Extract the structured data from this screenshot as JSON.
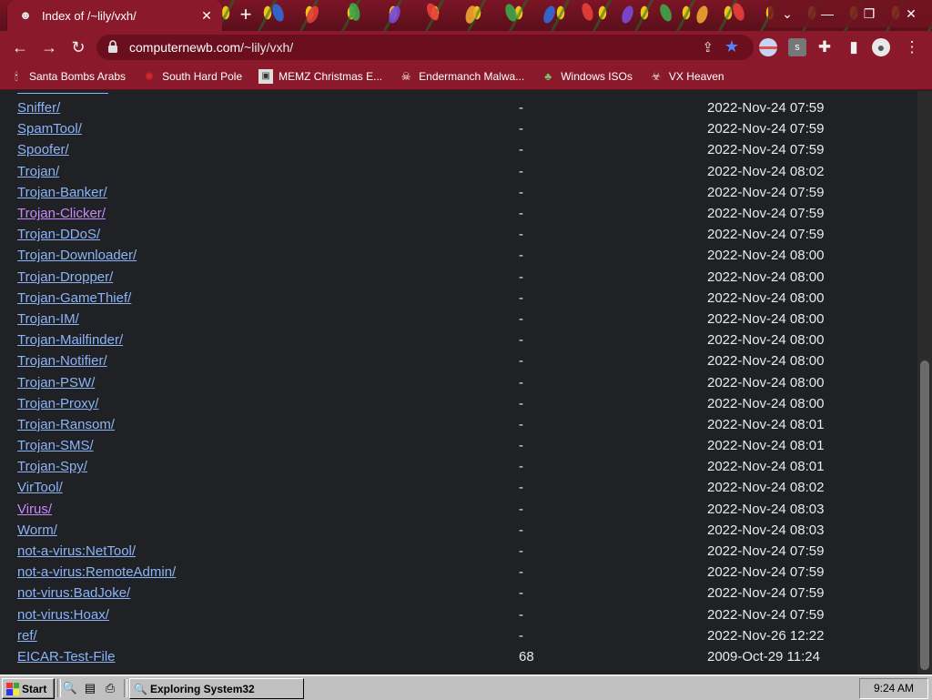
{
  "browser": {
    "tab_title": "Index of /~lily/vxh/",
    "url_host": "computernewb.com",
    "url_path": "/~lily/vxh/"
  },
  "bookmarks": [
    {
      "label": "Santa Bombs Arabs",
      "icon": "candle-icon"
    },
    {
      "label": "South Hard Pole",
      "icon": "asterisk-icon"
    },
    {
      "label": "MEMZ Christmas E...",
      "icon": "image-icon"
    },
    {
      "label": "Endermanch Malwa...",
      "icon": "skull-icon"
    },
    {
      "label": "Windows ISOs",
      "icon": "tree-icon"
    },
    {
      "label": "VX Heaven",
      "icon": "biohazard-icon"
    }
  ],
  "listing": [
    {
      "name": "Sniffer/",
      "size": "-",
      "date": "2022-Nov-24 07:59"
    },
    {
      "name": "SpamTool/",
      "size": "-",
      "date": "2022-Nov-24 07:59"
    },
    {
      "name": "Spoofer/",
      "size": "-",
      "date": "2022-Nov-24 07:59"
    },
    {
      "name": "Trojan/",
      "size": "-",
      "date": "2022-Nov-24 08:02"
    },
    {
      "name": "Trojan-Banker/",
      "size": "-",
      "date": "2022-Nov-24 07:59"
    },
    {
      "name": "Trojan-Clicker/",
      "size": "-",
      "date": "2022-Nov-24 07:59",
      "visited": true
    },
    {
      "name": "Trojan-DDoS/",
      "size": "-",
      "date": "2022-Nov-24 07:59"
    },
    {
      "name": "Trojan-Downloader/",
      "size": "-",
      "date": "2022-Nov-24 08:00"
    },
    {
      "name": "Trojan-Dropper/",
      "size": "-",
      "date": "2022-Nov-24 08:00"
    },
    {
      "name": "Trojan-GameThief/",
      "size": "-",
      "date": "2022-Nov-24 08:00"
    },
    {
      "name": "Trojan-IM/",
      "size": "-",
      "date": "2022-Nov-24 08:00"
    },
    {
      "name": "Trojan-Mailfinder/",
      "size": "-",
      "date": "2022-Nov-24 08:00"
    },
    {
      "name": "Trojan-Notifier/",
      "size": "-",
      "date": "2022-Nov-24 08:00"
    },
    {
      "name": "Trojan-PSW/",
      "size": "-",
      "date": "2022-Nov-24 08:00"
    },
    {
      "name": "Trojan-Proxy/",
      "size": "-",
      "date": "2022-Nov-24 08:00"
    },
    {
      "name": "Trojan-Ransom/",
      "size": "-",
      "date": "2022-Nov-24 08:01"
    },
    {
      "name": "Trojan-SMS/",
      "size": "-",
      "date": "2022-Nov-24 08:01"
    },
    {
      "name": "Trojan-Spy/",
      "size": "-",
      "date": "2022-Nov-24 08:01"
    },
    {
      "name": "VirTool/",
      "size": "-",
      "date": "2022-Nov-24 08:02"
    },
    {
      "name": "Virus/",
      "size": "-",
      "date": "2022-Nov-24 08:03",
      "visited": true
    },
    {
      "name": "Worm/",
      "size": "-",
      "date": "2022-Nov-24 08:03"
    },
    {
      "name": "not-a-virus:NetTool/",
      "size": "-",
      "date": "2022-Nov-24 07:59"
    },
    {
      "name": "not-a-virus:RemoteAdmin/",
      "size": "-",
      "date": "2022-Nov-24 07:59"
    },
    {
      "name": "not-virus:BadJoke/",
      "size": "-",
      "date": "2022-Nov-24 07:59"
    },
    {
      "name": "not-virus:Hoax/",
      "size": "-",
      "date": "2022-Nov-24 07:59"
    },
    {
      "name": "ref/",
      "size": "-",
      "date": "2022-Nov-26 12:22"
    },
    {
      "name": "EICAR-Test-File",
      "size": "68",
      "date": "2009-Oct-29 11:24"
    }
  ],
  "taskbar": {
    "start_label": "Start",
    "task_label": "Exploring System32",
    "clock": "9:24 AM"
  },
  "colors": {
    "link": "#8ab4f8",
    "visited_link": "#c58af9",
    "browser_frame": "#8a1a2b",
    "page_bg": "#202124"
  }
}
